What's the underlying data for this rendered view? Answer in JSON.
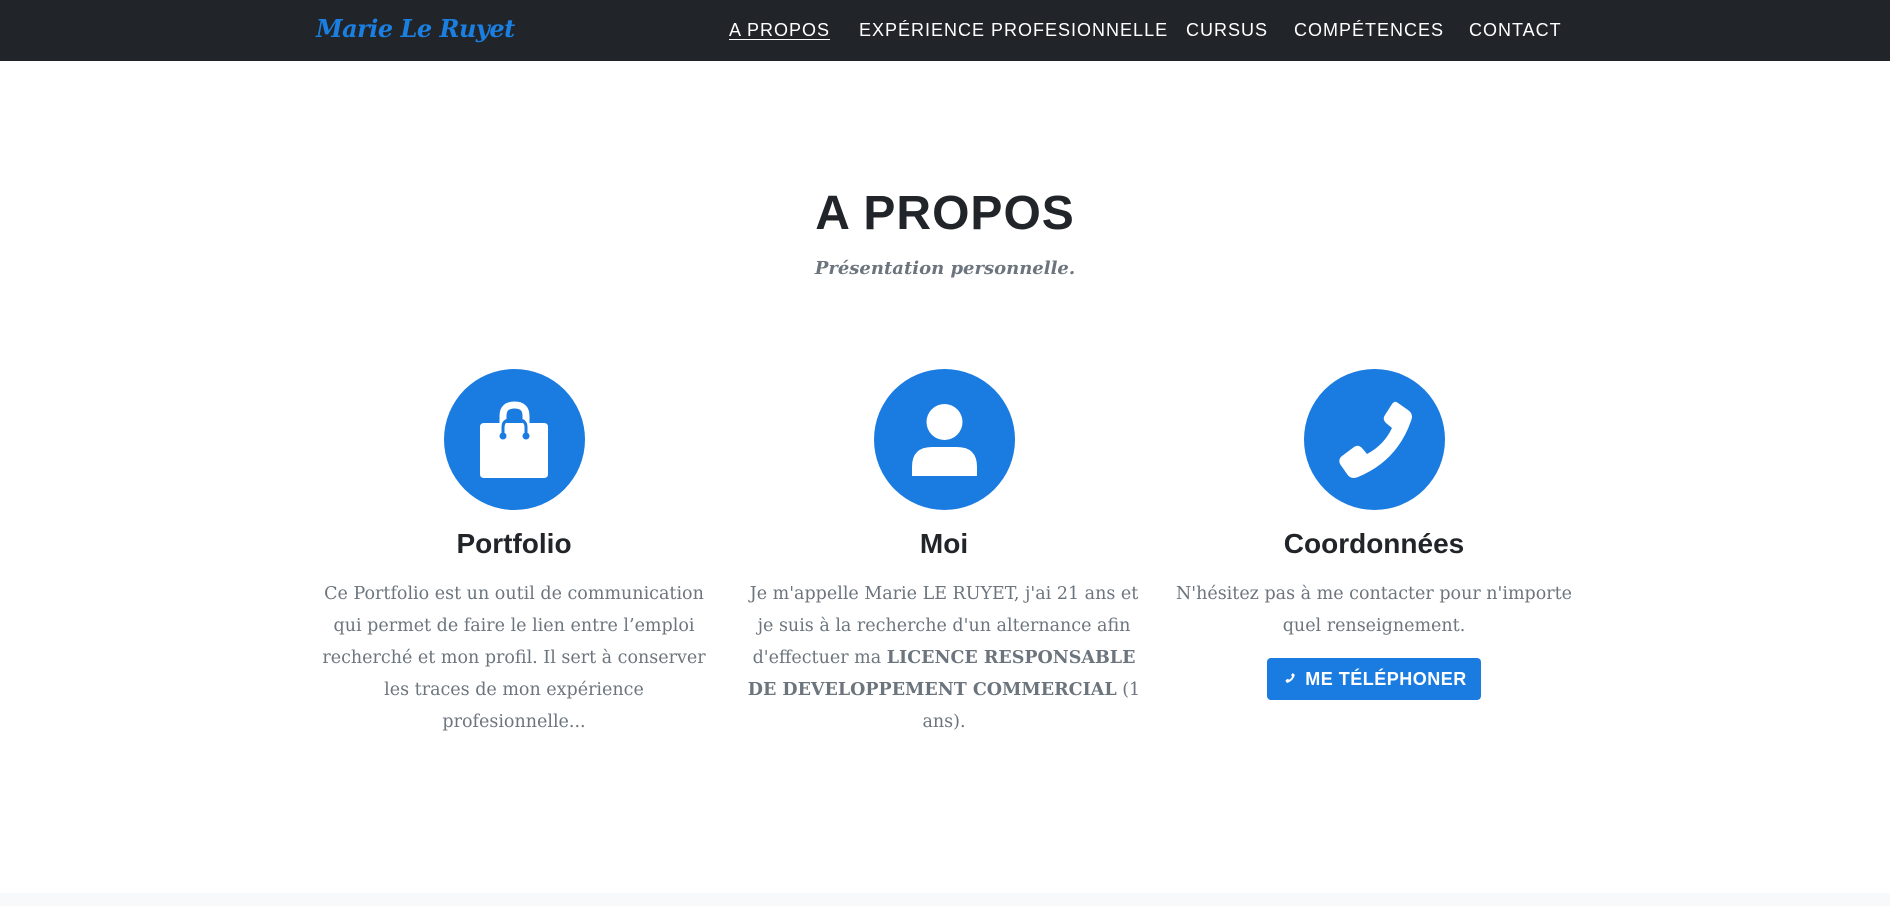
{
  "navbar": {
    "brand": "Marie Le Ruyet",
    "links": [
      {
        "label": "A PROPOS",
        "active": true
      },
      {
        "label": "EXPÉRIENCE PROFESIONNELLE"
      },
      {
        "label": "CURSUS"
      },
      {
        "label": "COMPÉTENCES"
      },
      {
        "label": "CONTACT"
      }
    ]
  },
  "about": {
    "heading": "A PROPOS",
    "subheading": "Présentation personnelle.",
    "columns": [
      {
        "icon": "shopping-bag-icon",
        "title": "Portfolio",
        "text": "Ce Portfolio est un outil de communication qui permet de faire le lien entre l’emploi recherché et mon profil. Il sert à conserver les traces de mon expérience profesionnelle..."
      },
      {
        "icon": "user-icon",
        "title": "Moi",
        "text_before": "Je m'appelle Marie LE RUYET, j'ai 21 ans et je suis à la recherche d'un alternance afin d'effectuer ma ",
        "text_bold": "LICENCE RESPONSABLE DE DEVELOPPEMENT COMMERCIAL",
        "text_after": " (1 ans)."
      },
      {
        "icon": "phone-icon",
        "title": "Coordonnées",
        "text": "N'hésitez pas à me contacter pour n'importe quel renseignement.",
        "button_label": "ME TÉLÉPHONER"
      }
    ]
  },
  "colors": {
    "navbar_bg": "#212529",
    "accent": "#1a7be0",
    "heading": "#212529",
    "muted": "#6c757d"
  }
}
